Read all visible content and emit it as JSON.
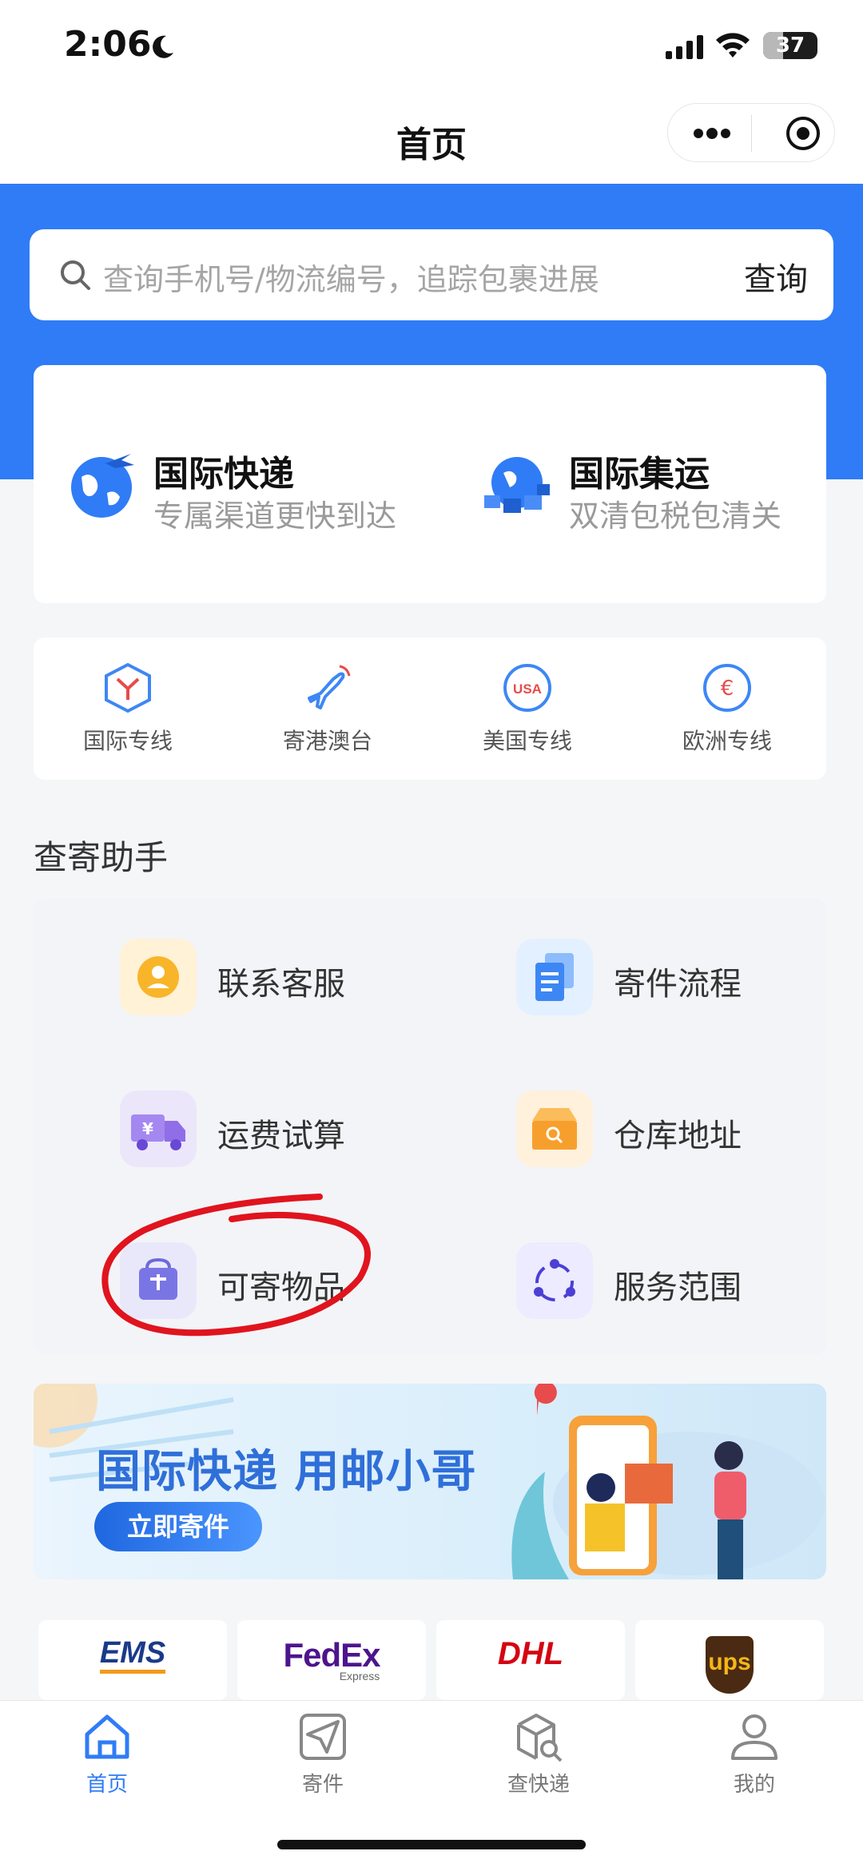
{
  "status_bar": {
    "time": "2:06",
    "battery": "37",
    "battery_level": 0.37
  },
  "nav": {
    "title": "首页"
  },
  "search": {
    "placeholder": "查询手机号/物流编号，追踪包裹进展",
    "button": "查询"
  },
  "features": [
    {
      "title": "国际快递",
      "subtitle": "专属渠道更快到达"
    },
    {
      "title": "国际集运",
      "subtitle": "双清包税包清关"
    }
  ],
  "lines": [
    {
      "label": "国际专线",
      "icon": "box-icon"
    },
    {
      "label": "寄港澳台",
      "icon": "plane-icon"
    },
    {
      "label": "美国专线",
      "icon": "usa-icon"
    },
    {
      "label": "欧洲专线",
      "icon": "euro-icon"
    }
  ],
  "assistant": {
    "title": "查寄助手",
    "items": [
      {
        "label": "联系客服",
        "icon": "customer-service-icon"
      },
      {
        "label": "寄件流程",
        "icon": "documents-icon"
      },
      {
        "label": "运费试算",
        "icon": "truck-fee-icon"
      },
      {
        "label": "仓库地址",
        "icon": "warehouse-box-icon"
      },
      {
        "label": "可寄物品",
        "icon": "bag-icon"
      },
      {
        "label": "服务范围",
        "icon": "network-icon"
      }
    ]
  },
  "banner": {
    "title": "国际快递 用邮小哥",
    "button": "立即寄件"
  },
  "carriers": [
    {
      "name": "EMS"
    },
    {
      "name": "FedEx",
      "sub": "Express"
    },
    {
      "name": "DHL"
    },
    {
      "name": "ups"
    }
  ],
  "tabs": [
    {
      "label": "首页",
      "icon": "home-icon",
      "active": true
    },
    {
      "label": "寄件",
      "icon": "send-icon",
      "active": false
    },
    {
      "label": "查快递",
      "icon": "track-package-icon",
      "active": false
    },
    {
      "label": "我的",
      "icon": "profile-icon",
      "active": false
    }
  ],
  "colors": {
    "primary": "#2f7cf6",
    "background": "#f5f6f8",
    "annotation": "#e0141e"
  }
}
